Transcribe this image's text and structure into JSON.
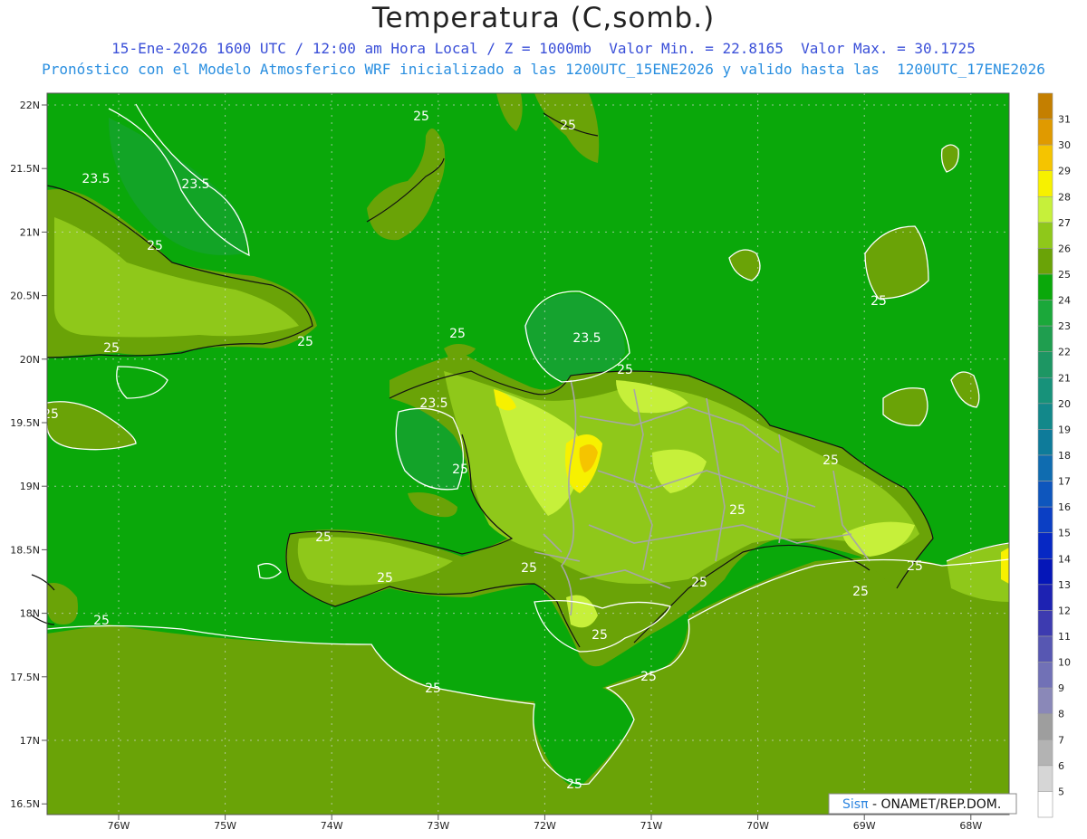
{
  "title": "Temperatura (C,somb.)",
  "subtitle1": "15-Ene-2026 1600 UTC / 12:00 am Hora Local / Z = 1000mb  Valor Min. = 22.8165  Valor Max. = 30.1725",
  "subtitle2": "Pronóstico con el Modelo Atmosferico WRF inicializado a las 1200UTC_15ENE2026 y valido hasta las  1200UTC_17ENE2026",
  "credit": {
    "brand": "Sisπ",
    "text": " - ONAMET/REP.DOM."
  },
  "lat_labels": [
    "22N",
    "21.5N",
    "21N",
    "20.5N",
    "20N",
    "19.5N",
    "19N",
    "18.5N",
    "18N",
    "17.5N",
    "17N",
    "16.5N"
  ],
  "lon_labels": [
    "76W",
    "75W",
    "74W",
    "73W",
    "72W",
    "71W",
    "70W",
    "69W",
    "68W"
  ],
  "colorbar": [
    {
      "v": "31",
      "c": "#c47f00"
    },
    {
      "v": "30",
      "c": "#e09a00"
    },
    {
      "v": "29",
      "c": "#f5c400"
    },
    {
      "v": "28",
      "c": "#f7f100"
    },
    {
      "v": "27",
      "c": "#c6f03a"
    },
    {
      "v": "26",
      "c": "#8fc81a"
    },
    {
      "v": "25",
      "c": "#6aa307"
    },
    {
      "v": "24",
      "c": "#0aa80a"
    },
    {
      "v": "23",
      "c": "#1ba83a"
    },
    {
      "v": "22",
      "c": "#1f9e4f"
    },
    {
      "v": "21",
      "c": "#1d9663"
    },
    {
      "v": "20",
      "c": "#17927a"
    },
    {
      "v": "19",
      "c": "#12888a"
    },
    {
      "v": "18",
      "c": "#0e7b9a"
    },
    {
      "v": "17",
      "c": "#0f6cb0"
    },
    {
      "v": "16",
      "c": "#0e56bd"
    },
    {
      "v": "15",
      "c": "#0b3fc4"
    },
    {
      "v": "14",
      "c": "#0628c4"
    },
    {
      "v": "13",
      "c": "#0516b8"
    },
    {
      "v": "12",
      "c": "#1d22b2"
    },
    {
      "v": "11",
      "c": "#3d3bb0"
    },
    {
      "v": "10",
      "c": "#5757b2"
    },
    {
      "v": "9",
      "c": "#7171b6"
    },
    {
      "v": "8",
      "c": "#8a88b8"
    },
    {
      "v": "7",
      "c": "#9e9e9e"
    },
    {
      "v": "6",
      "c": "#b3b3b3"
    },
    {
      "v": "5",
      "c": "#d6d6d6"
    },
    {
      "v": "",
      "c": "#ffffff"
    }
  ],
  "contour_labels": [
    "25",
    "25",
    "23.5",
    "23.5",
    "25",
    "25",
    "25",
    "23.5",
    "25",
    "25",
    "23.5",
    "25",
    "25",
    "25",
    "25",
    "25",
    "25",
    "25",
    "25",
    "25",
    "25",
    "25",
    "25",
    "25",
    "25",
    "25"
  ],
  "colors": {
    "sea": "#0aa80a",
    "land_low": "#6aa307",
    "land_mid": "#8fc81a",
    "land_high": "#c6f03a",
    "hot": "#f7f100",
    "hotter": "#f5c400",
    "cool_sea": "#1f9e4f"
  }
}
